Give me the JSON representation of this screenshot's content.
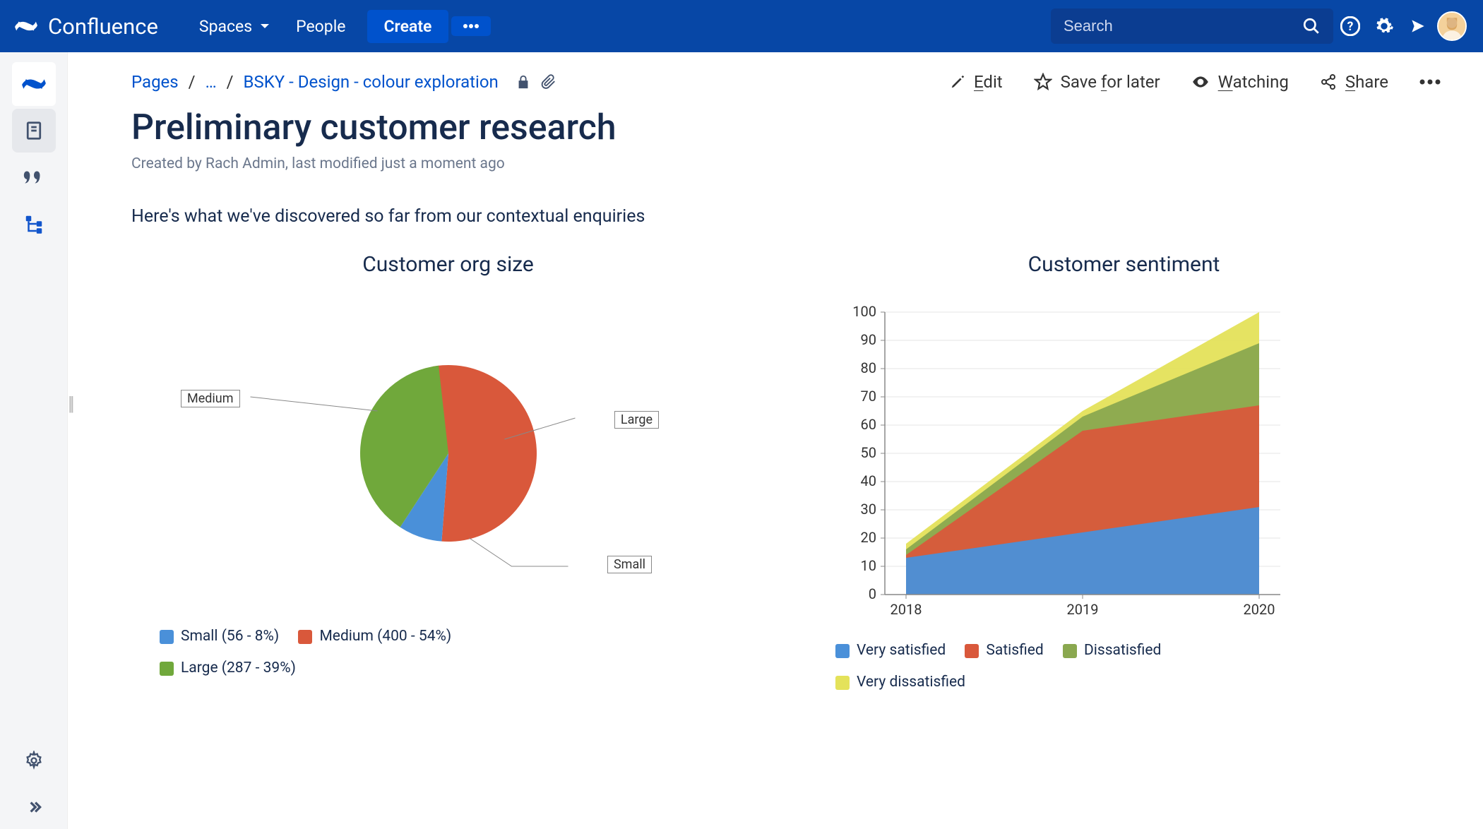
{
  "header": {
    "brand": "Confluence",
    "nav": {
      "spaces": "Spaces",
      "people": "People",
      "create": "Create"
    },
    "search_placeholder": "Search"
  },
  "breadcrumb": {
    "root": "Pages",
    "ellipsis": "…",
    "current": "BSKY - Design - colour exploration"
  },
  "actions": {
    "edit": "Edit",
    "save": "Save for later",
    "watching": "Watching",
    "share": "Share"
  },
  "page": {
    "title": "Preliminary customer research",
    "byline": "Created by Rach Admin, last modified just a moment ago",
    "intro": "Here's what we've discovered so far from our contextual enquiries"
  },
  "charts": {
    "pie_title": "Customer org size",
    "area_title": "Customer sentiment",
    "pie_labels": {
      "small": "Small",
      "medium": "Medium",
      "large": "Large"
    },
    "pie_legend": {
      "small": "Small (56 - 8%)",
      "medium": "Medium (400 - 54%)",
      "large": "Large (287 - 39%)"
    },
    "area_legend": {
      "vs": "Very satisfied",
      "s": "Satisfied",
      "d": "Dissatisfied",
      "vd": "Very dissatisfied"
    }
  },
  "colors": {
    "blue": "#4a90d9",
    "orange": "#d9583b",
    "green": "#70a83b",
    "yellow": "#e4e25a",
    "olive": "#8aa84f"
  },
  "chart_data": [
    {
      "type": "pie",
      "title": "Customer org size",
      "series": [
        {
          "name": "Small",
          "value": 56,
          "percent": 8,
          "color": "#4a90d9"
        },
        {
          "name": "Medium",
          "value": 400,
          "percent": 54,
          "color": "#d9583b"
        },
        {
          "name": "Large",
          "value": 287,
          "percent": 39,
          "color": "#70a83b"
        }
      ]
    },
    {
      "type": "area",
      "title": "Customer sentiment",
      "categories": [
        "2018",
        "2019",
        "2020"
      ],
      "ylim": [
        0,
        100
      ],
      "yticks": [
        0,
        10,
        20,
        30,
        40,
        50,
        60,
        70,
        80,
        90,
        100
      ],
      "series": [
        {
          "name": "Very satisfied",
          "values": [
            13,
            22,
            31
          ],
          "color": "#4a90d9"
        },
        {
          "name": "Satisfied",
          "values": [
            1,
            36,
            36
          ],
          "color": "#d9583b"
        },
        {
          "name": "Dissatisfied",
          "values": [
            2,
            5,
            22
          ],
          "color": "#8aa84f"
        },
        {
          "name": "Very dissatisfied",
          "values": [
            2,
            2,
            11
          ],
          "color": "#e4e25a"
        }
      ],
      "stacked": true
    }
  ]
}
